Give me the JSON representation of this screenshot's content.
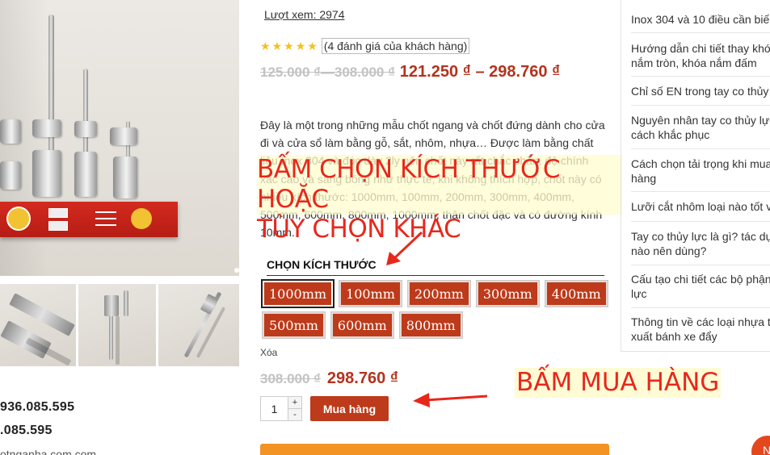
{
  "gallery": {
    "main_image": "door-bolt-product-photo",
    "thumbnails": [
      "door-bolt-thumbnail-1",
      "door-bolt-thumbnail-2",
      "door-bolt-thumbnail-3"
    ],
    "phone_1": "936.085.595",
    "phone_2": ".085.595",
    "website": "otnganha.com.com"
  },
  "product": {
    "views": "Lượt xem: 2974",
    "rating": {
      "stars": 5,
      "max": 5,
      "review_text": "(4 đánh giá của khách hàng)"
    },
    "price": {
      "old_range": "125.000 ₫—308.000 ₫",
      "new_range": "121.250 ₫ – 298.760 ₫"
    },
    "description": "Đây là một trong những mẫu chốt ngang và chốt đứng dành cho cửa đi và cửa sổ làm bằng gỗ, sắt, nhôm, nhựa… Được làm bằng chất liệu Inox 304 và đúc dày 2ly nên chốt này rất chắc chắn, độ chính xác cao và sáng bóng như thực tế, khi không thích hợp, chốt này có nhiều kích thước: 1000mm, 100mm, 200mm, 300mm, 400mm, 500mm, 600mm, 800mm, 1000mm, thân chốt đặc và có đường kính 10mm.",
    "size_title": "CHỌN KÍCH THƯỚC",
    "sizes_row1": [
      "1000mm",
      "100mm",
      "200mm",
      "300mm",
      "400mm"
    ],
    "sizes_row2": [
      "500mm",
      "600mm",
      "800mm"
    ],
    "selected_size": "1000mm",
    "clear_label": "Xóa",
    "variation_price": {
      "old": "308.000 ₫",
      "new": "298.760 ₫"
    },
    "quantity": "1",
    "qty_plus": "+",
    "qty_minus": "-",
    "buy_label": "Mua hàng"
  },
  "annotations": {
    "size_note_line1": "BẤM CHỌN KÍCH THƯỚC HOẶC",
    "size_note_line2": "TÙY CHỌN KHÁC",
    "buy_note": "BẤM MUA HÀNG",
    "color": "#e8271b"
  },
  "sidebar": {
    "items": [
      [
        "Inox 304 và 10 điều cần biế"
      ],
      [
        "Hướng dẫn chi tiết thay khó",
        "nắm tròn, khóa nắm đấm"
      ],
      [
        "Chỉ số EN trong tay co thủy"
      ],
      [
        "Nguyên nhân tay co thủy lực",
        "cách khắc phục"
      ],
      [
        "Cách chọn tải trọng khi mua",
        "hàng"
      ],
      [
        "Lưỡi cắt nhôm loại nào tốt v"
      ],
      [
        "Tay co thủy lực là gì? tác dụ",
        "nào nên dùng?"
      ],
      [
        "Cấu tạo chi tiết các bộ phận",
        "lực"
      ],
      [
        "Thông tin về các loại nhựa t",
        "xuất bánh xe đẩy"
      ]
    ]
  },
  "floating_button": {
    "label": "N"
  },
  "colors": {
    "accent": "#bd3a1a",
    "price": "#b3331d",
    "star": "#f3c01c",
    "orange": "#f39324"
  }
}
